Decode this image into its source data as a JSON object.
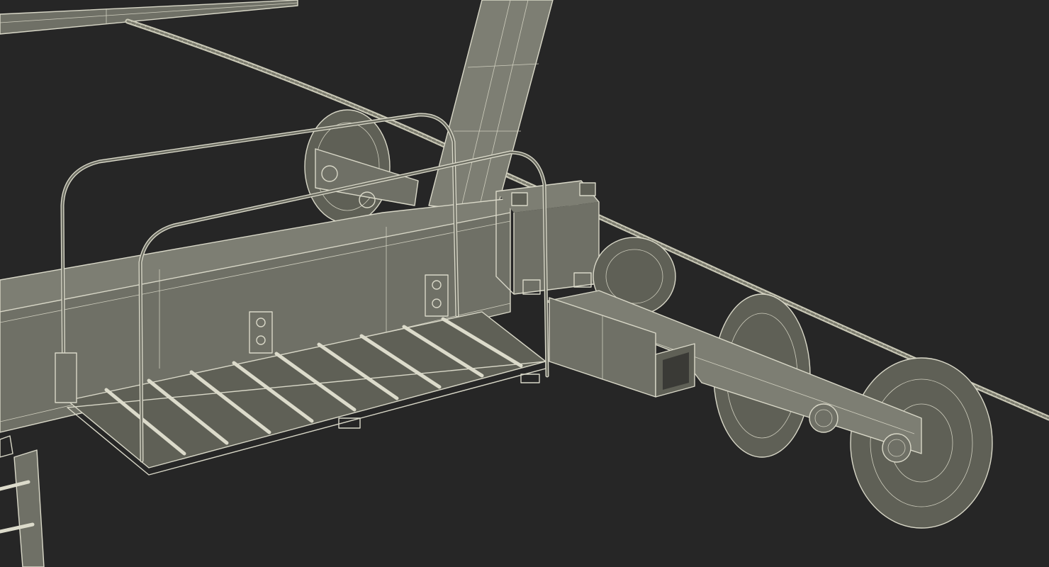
{
  "scene": {
    "subject": "lift-carriage-wireframe-render",
    "background_color": "#262626",
    "wire_color": "#d9d8c8",
    "surface_color": "#6f7066"
  }
}
